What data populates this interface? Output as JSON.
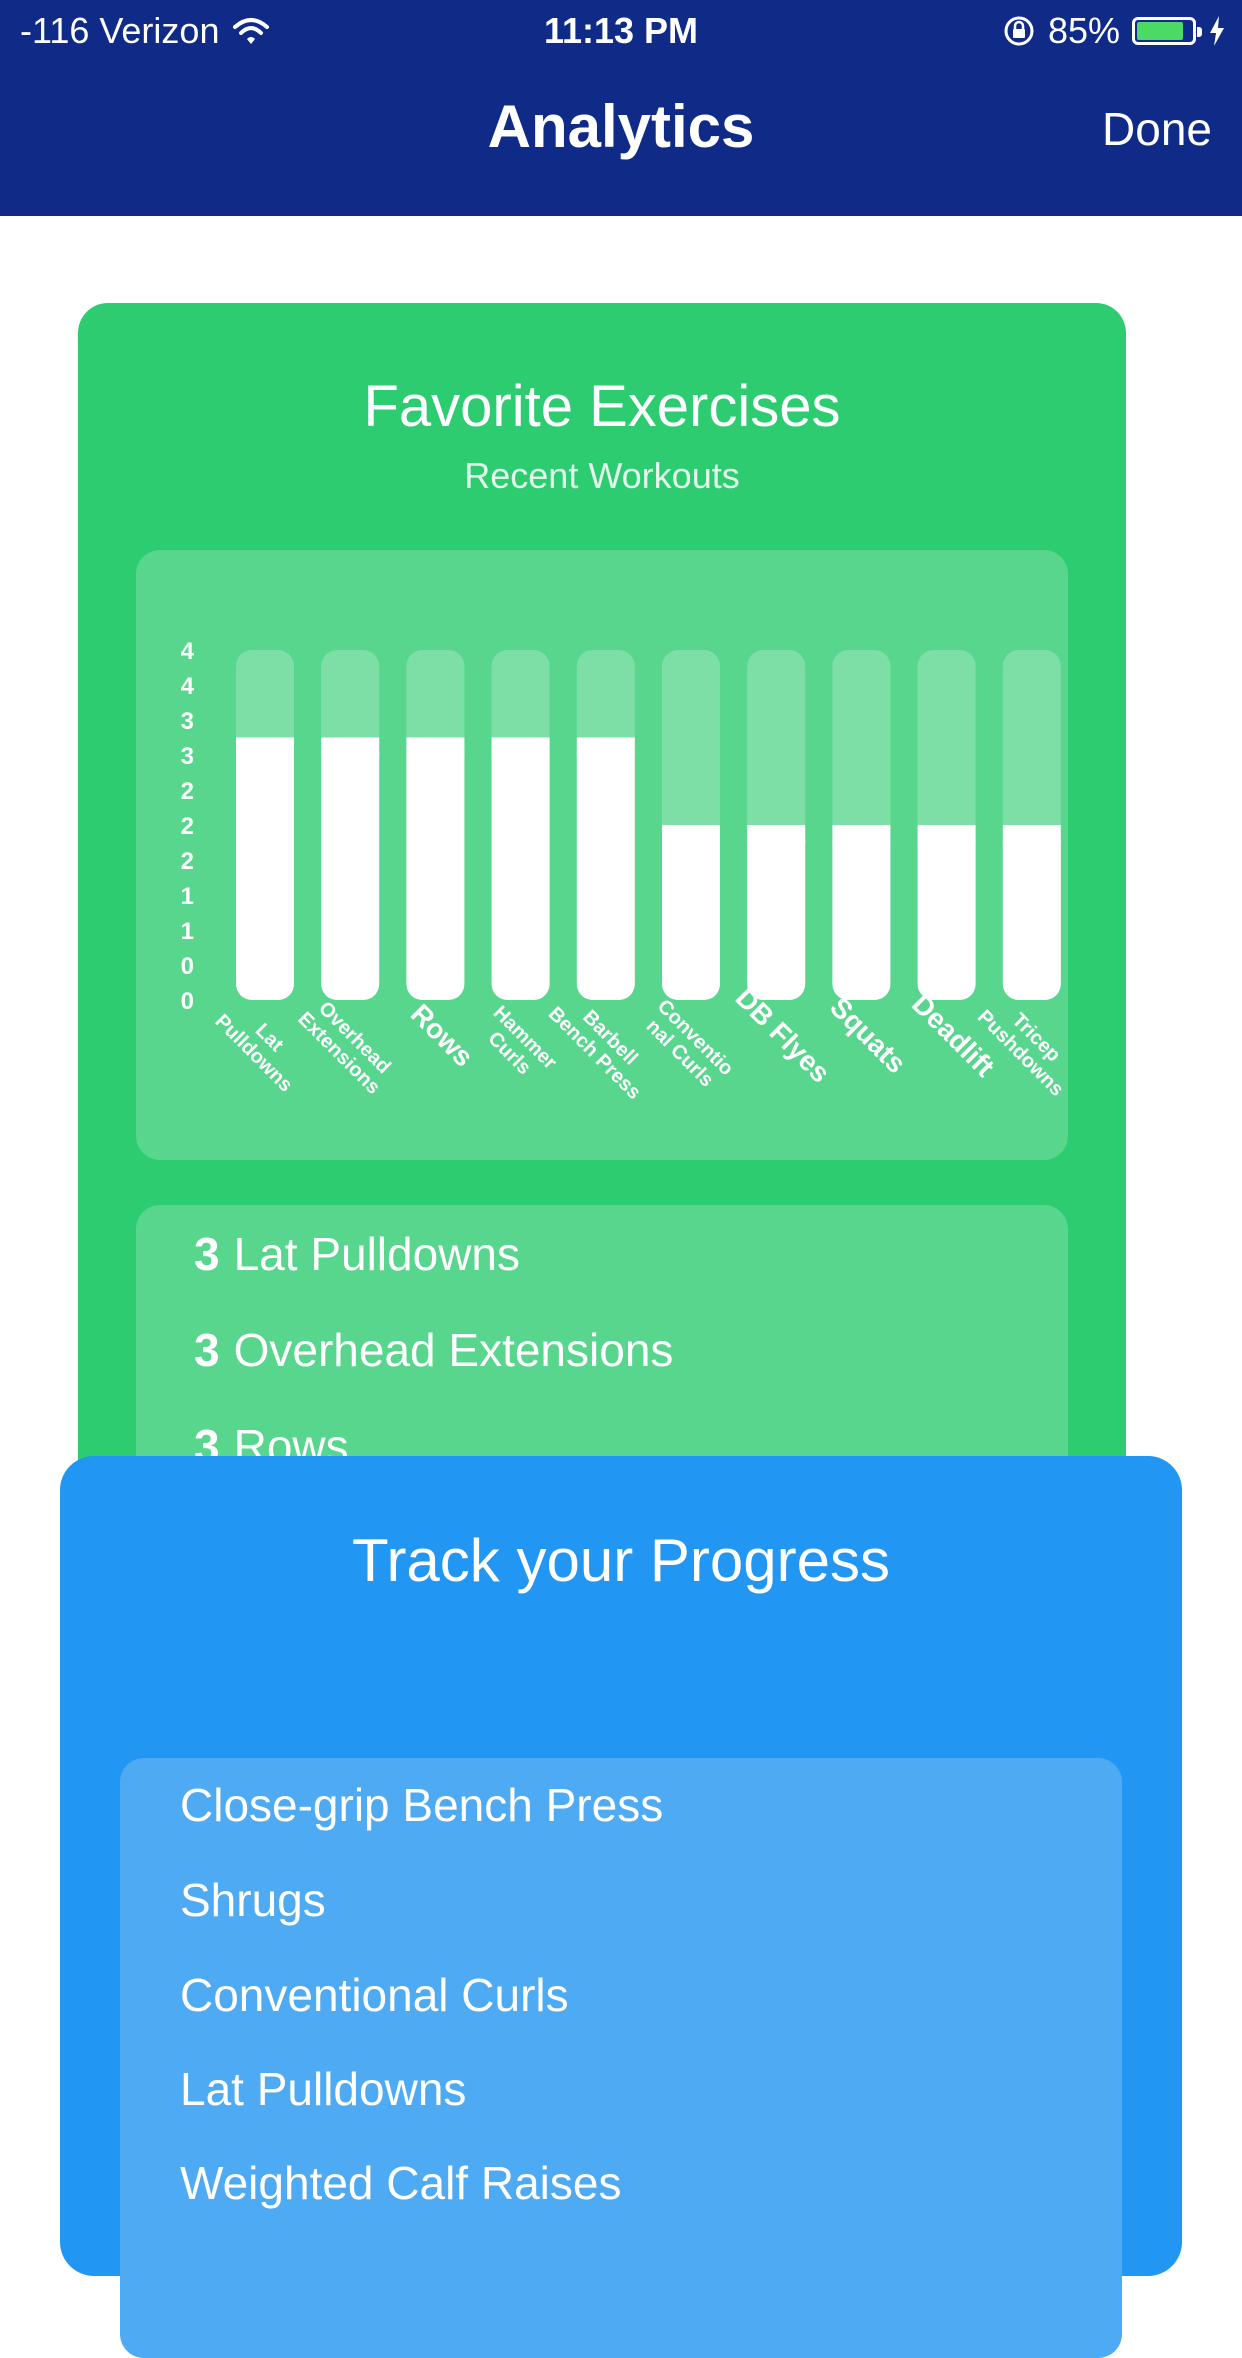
{
  "status_bar": {
    "carrier": "-116 Verizon",
    "time": "11:13 PM",
    "battery": "85%",
    "battery_level": 0.85,
    "icons": [
      "wifi-icon",
      "rotation-lock-icon",
      "battery-icon",
      "charging-icon"
    ]
  },
  "nav": {
    "title": "Analytics",
    "done_label": "Done"
  },
  "favorites": {
    "title": "Favorite Exercises",
    "subtitle": "Recent Workouts",
    "list": [
      {
        "count": "3",
        "name": "Lat Pulldowns"
      },
      {
        "count": "3",
        "name": "Overhead Extensions"
      },
      {
        "count": "3",
        "name": "Rows"
      }
    ]
  },
  "chart_data": {
    "type": "bar",
    "categories": [
      "Lat Pulldowns",
      "Overhead Extensions",
      "Rows",
      "Hammer Curls",
      "Barbell Bench Press",
      "Conventional Curls",
      "DB Flyes",
      "Squats",
      "Deadlift",
      "Tricep Pushdowns"
    ],
    "category_labels": [
      [
        "Lat",
        "Pulldowns"
      ],
      [
        "Overhead",
        "Extensions"
      ],
      [
        "Rows"
      ],
      [
        "Hammer",
        "Curls"
      ],
      [
        "Barbell",
        "Bench Press"
      ],
      [
        "Conventio",
        "nal Curls"
      ],
      [
        "DB Flyes"
      ],
      [
        "Squats"
      ],
      [
        "Deadlift"
      ],
      [
        "Tricep",
        "Pushdowns"
      ]
    ],
    "values": [
      3,
      3,
      3,
      3,
      3,
      2,
      2,
      2,
      2,
      2
    ],
    "ylim": [
      0,
      4
    ],
    "y_tick_labels": [
      "4",
      "4",
      "3",
      "3",
      "2",
      "2",
      "2",
      "1",
      "1",
      "0",
      "0"
    ],
    "colors": {
      "bar": "#ffffff",
      "track": "#7ddfa6",
      "panel": "#58d68d"
    }
  },
  "progress": {
    "title": "Track your Progress",
    "exercises": [
      "Close-grip Bench Press",
      "Shrugs",
      "Conventional Curls",
      "Lat Pulldowns",
      "Weighted Calf Raises"
    ]
  },
  "colors": {
    "nav_bg": "#0f2a87",
    "green_card": "#2ecc71",
    "green_panel": "#58d68d",
    "blue_card": "#2196f3",
    "blue_panel": "#4faaf4",
    "battery_fill": "#4cd964"
  }
}
